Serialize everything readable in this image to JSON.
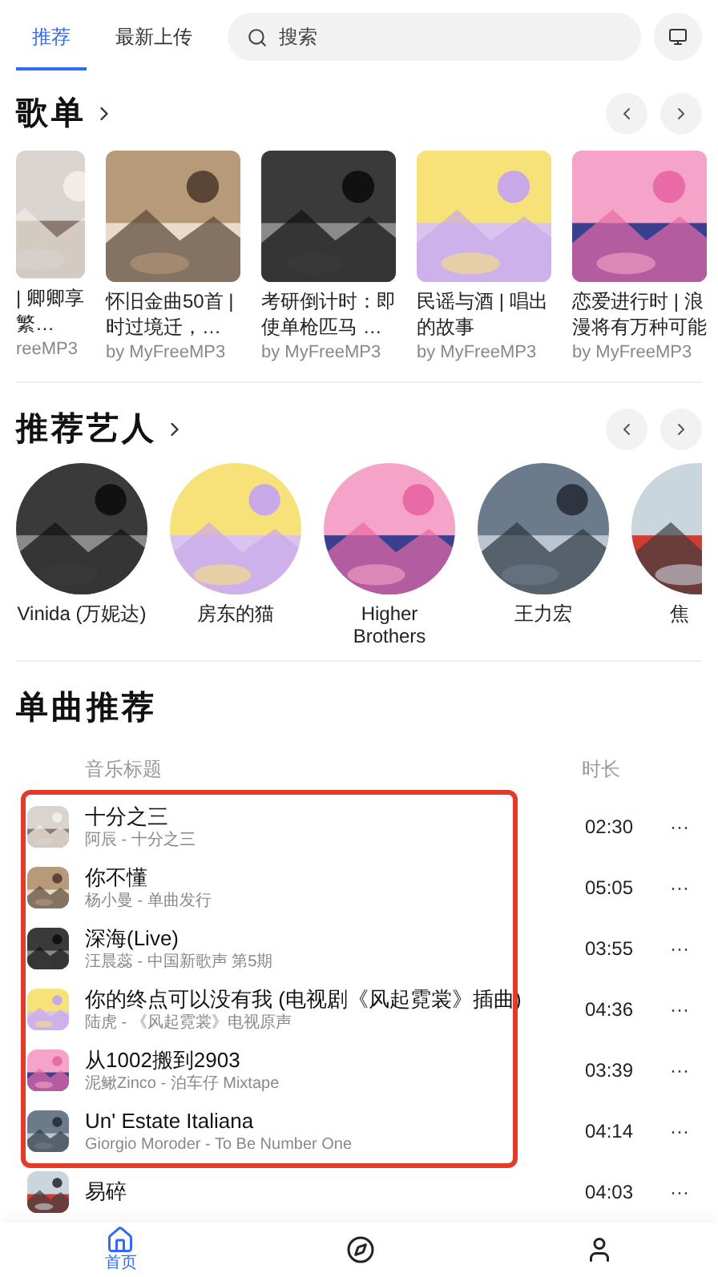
{
  "tabs": [
    {
      "label": "推荐",
      "selected": true
    },
    {
      "label": "最新上传",
      "selected": false
    }
  ],
  "search": {
    "placeholder": "搜索"
  },
  "playlists": {
    "title": "歌单",
    "items": [
      {
        "title": "| 卿卿享繁…",
        "author": "reeMP3"
      },
      {
        "title": "怀旧金曲50首 | 时过境迁，…",
        "author": "by MyFreeMP3"
      },
      {
        "title": "考研倒计时：即使单枪匹马 …",
        "author": "by MyFreeMP3"
      },
      {
        "title": "民谣与酒 | 唱出的故事",
        "author": "by MyFreeMP3"
      },
      {
        "title": "恋爱进行时 | 浪漫将有万种可能",
        "author": "by MyFreeMP3"
      }
    ]
  },
  "artists": {
    "title": "推荐艺人",
    "items": [
      {
        "name": "Vinida (万妮达)"
      },
      {
        "name": "房东的猫"
      },
      {
        "name": "Higher Brothers"
      },
      {
        "name": "王力宏"
      },
      {
        "name": "焦"
      }
    ]
  },
  "songs": {
    "title": "单曲推荐",
    "columns": [
      "音乐标题",
      "时长"
    ],
    "rows": [
      {
        "title": "十分之三",
        "subtitle": "阿辰 - 十分之三",
        "duration": "02:30",
        "more": "···"
      },
      {
        "title": "你不懂",
        "subtitle": "杨小曼 - 单曲发行",
        "duration": "05:05",
        "more": "···"
      },
      {
        "title": "深海(Live)",
        "subtitle": "汪晨蕊 - 中国新歌声 第5期",
        "duration": "03:55",
        "more": "···"
      },
      {
        "title": "你的终点可以没有我 (电视剧《风起霓裳》插曲)",
        "subtitle": "陆虎 - 《风起霓裳》电视原声",
        "duration": "04:36",
        "more": "···"
      },
      {
        "title": "从1002搬到2903",
        "subtitle": "泥鳅Zinco - 泊车仔 Mixtape",
        "duration": "03:39",
        "more": "···"
      },
      {
        "title": "Un' Estate Italiana",
        "subtitle": "Giorgio Moroder - To Be Number One",
        "duration": "04:14",
        "more": "···"
      },
      {
        "title": "易碎",
        "duration": "04:03",
        "more": "···"
      }
    ]
  },
  "nav": [
    {
      "kind": "home",
      "label": "首页",
      "selected": true
    },
    {
      "kind": "explore",
      "selected": false
    },
    {
      "kind": "profile",
      "selected": false
    }
  ]
}
